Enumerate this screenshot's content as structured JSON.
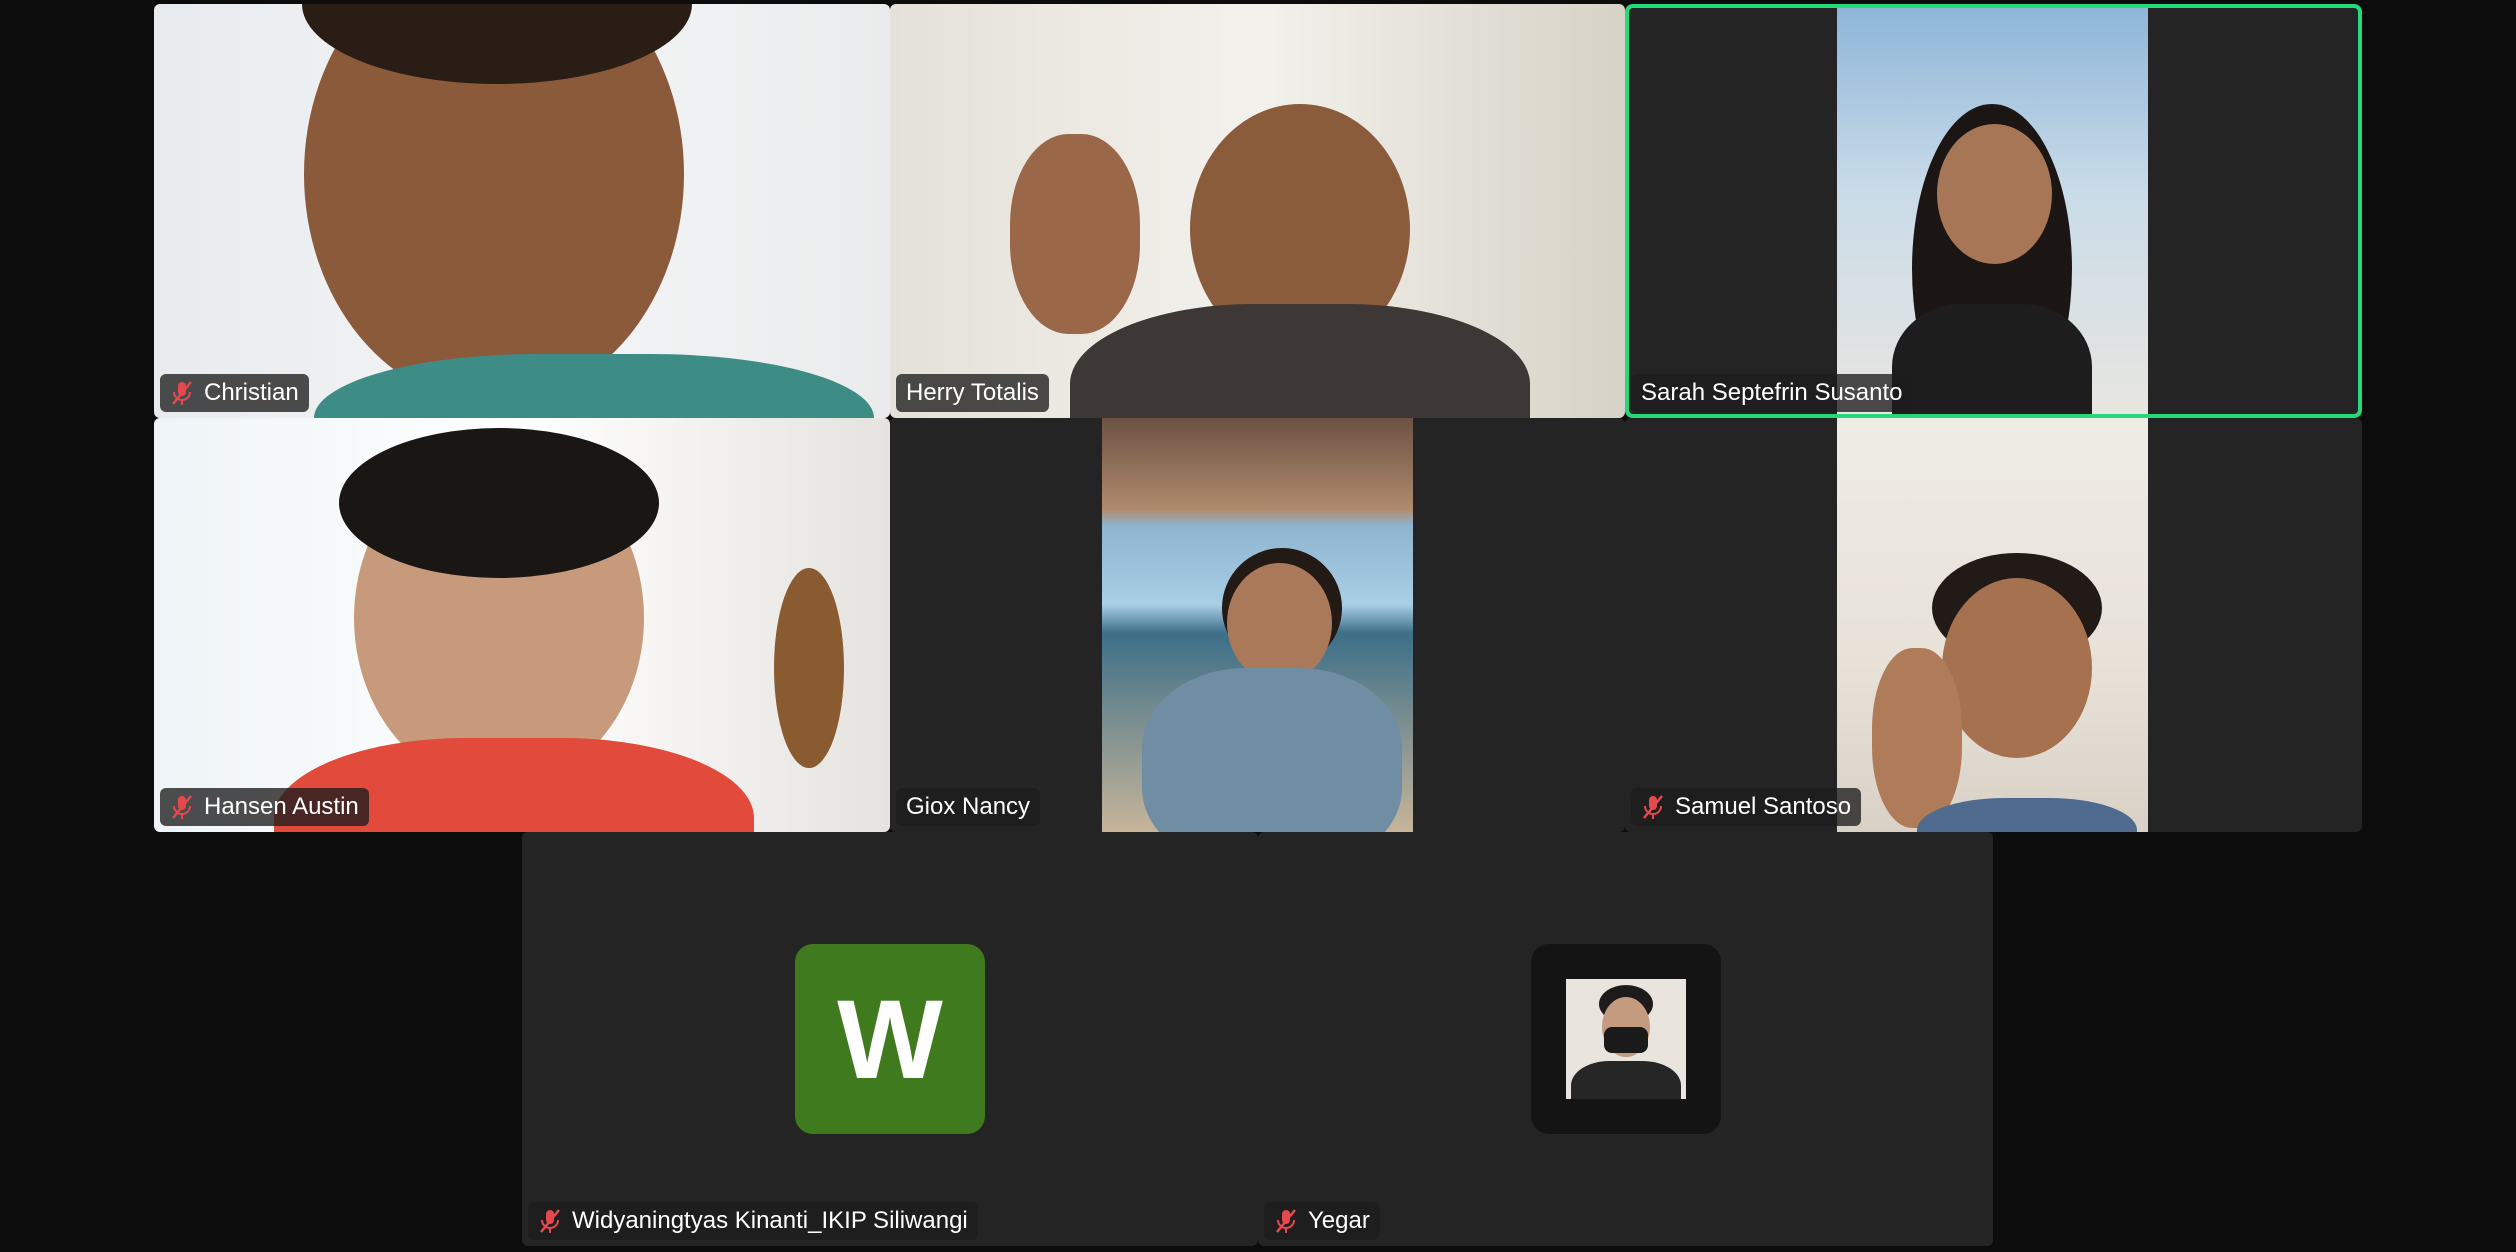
{
  "participants": [
    {
      "name": "Christian",
      "muted": true
    },
    {
      "name": "Herry Totalis",
      "muted": false
    },
    {
      "name": "Sarah Septefrin Susanto",
      "muted": false,
      "active_speaker": true
    },
    {
      "name": "Hansen Austin",
      "muted": true
    },
    {
      "name": "Giox Nancy",
      "muted": false
    },
    {
      "name": "Samuel Santoso",
      "muted": true
    },
    {
      "name": "Widyaningtyas Kinanti_IKIP Siliwangi",
      "muted": true,
      "avatar_letter": "W"
    },
    {
      "name": "Yegar",
      "muted": true
    }
  ],
  "colors": {
    "active_border": "#23d97a",
    "mute_icon": "#e5484d",
    "avatar_w": "#3f7a1e"
  },
  "icons": {
    "muted": "microphone-muted-icon"
  }
}
